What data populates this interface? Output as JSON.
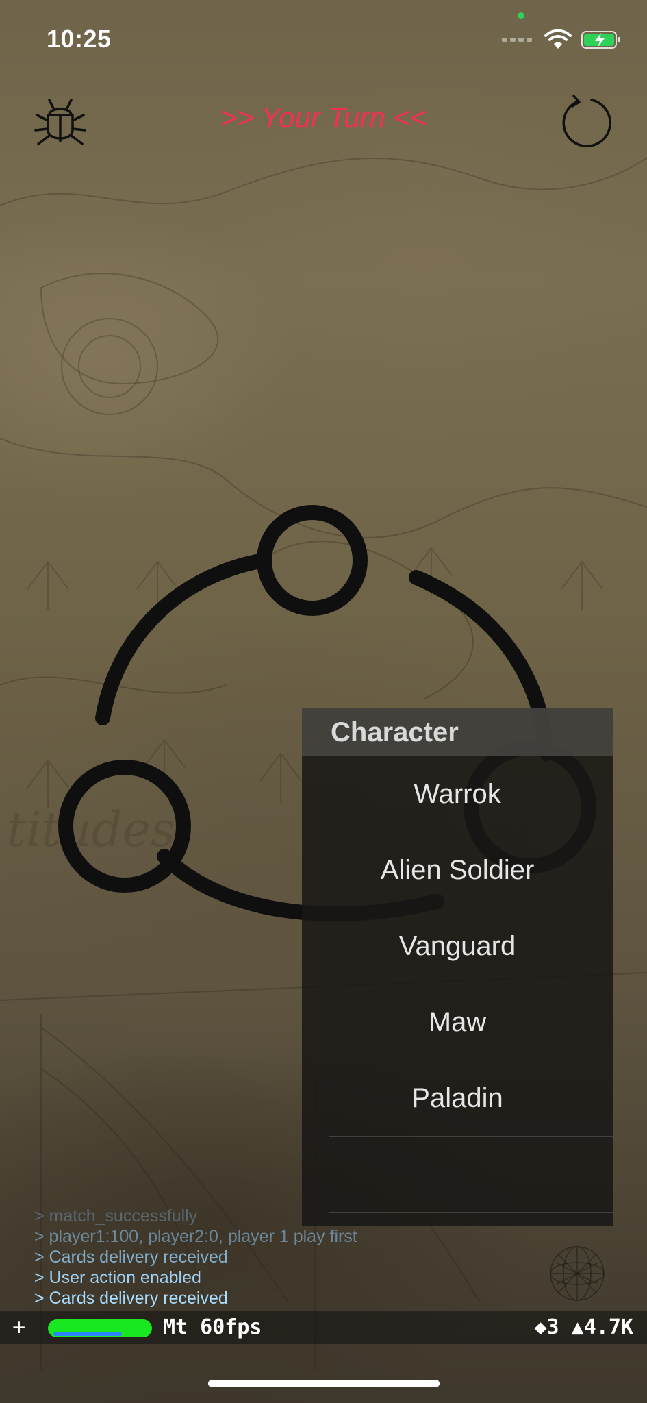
{
  "status_bar": {
    "time": "10:25"
  },
  "header": {
    "title": ">> Your Turn <<",
    "bug_icon": "bug-icon",
    "refresh_icon": "refresh-icon"
  },
  "picker": {
    "title": "Character",
    "options": [
      "Warrok",
      "Alien Soldier",
      "Vanguard",
      "Maw",
      "Paladin",
      ""
    ]
  },
  "console_log": [
    {
      "text": "> match_successfully",
      "color": "#6f8fa8"
    },
    {
      "text": "> player1:100, player2:0, player 1 play first",
      "color": "#7fa8c8"
    },
    {
      "text": "> Cards delivery received",
      "color": "#8ec2e6"
    },
    {
      "text": "> User action enabled",
      "color": "#9fd2f4"
    },
    {
      "text": "> Cards delivery received",
      "color": "#a8dcff"
    }
  ],
  "stats": {
    "plus": "+",
    "fps": "Mt 60fps",
    "counts": "◆3 ▲4.7K",
    "fps_level": 1.0
  },
  "colors": {
    "accent": "#f2314e",
    "fps_bar": "#17e820"
  }
}
